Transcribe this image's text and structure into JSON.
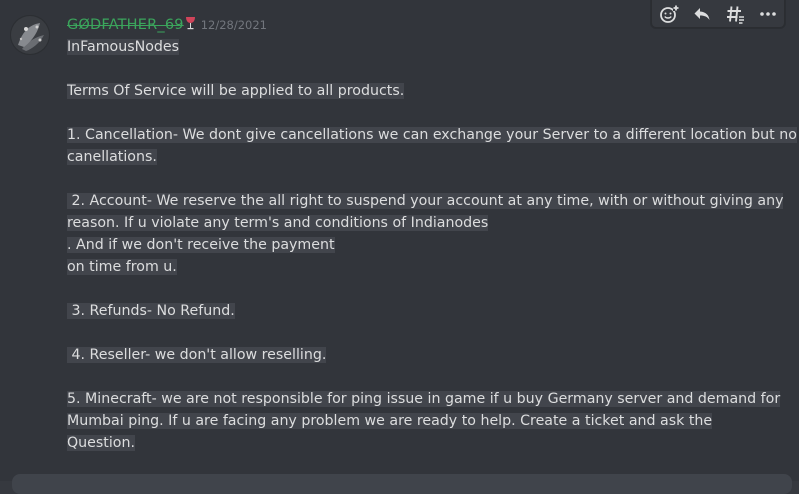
{
  "message": {
    "username": "GØDFATHER_69",
    "timestamp": "12/28/2021",
    "lines": [
      "InFamousNodes",
      "",
      "Terms Of Service will be applied to all products.",
      "",
      "1. Cancellation- We dont give cancellations we can exchange your Server to a different location but no",
      "canellations.",
      "",
      " 2. Account- We reserve the all right to suspend your account at any time, with or without giving any",
      "reason. If u violate any term's and conditions of Indianodes",
      ". And if we don't receive the payment",
      "on time from u.",
      "",
      " 3. Refunds- No Refund.",
      "",
      " 4. Reseller- we don't allow reselling.",
      "",
      "5. Minecraft- we are not responsible for ping issue in game if u buy Germany server and demand for",
      "Mumbai ping. If u are facing any problem we are ready to help. Create a ticket and ask the",
      "Question."
    ]
  },
  "toolbar": {
    "icons": [
      "add-reaction-icon",
      "reply-icon",
      "create-thread-icon",
      "more-icon"
    ]
  },
  "colors": {
    "background": "#32353b",
    "username": "#3ba55c",
    "text": "#dcddde",
    "timestamp": "#72767d",
    "highlight": "#42454c"
  }
}
